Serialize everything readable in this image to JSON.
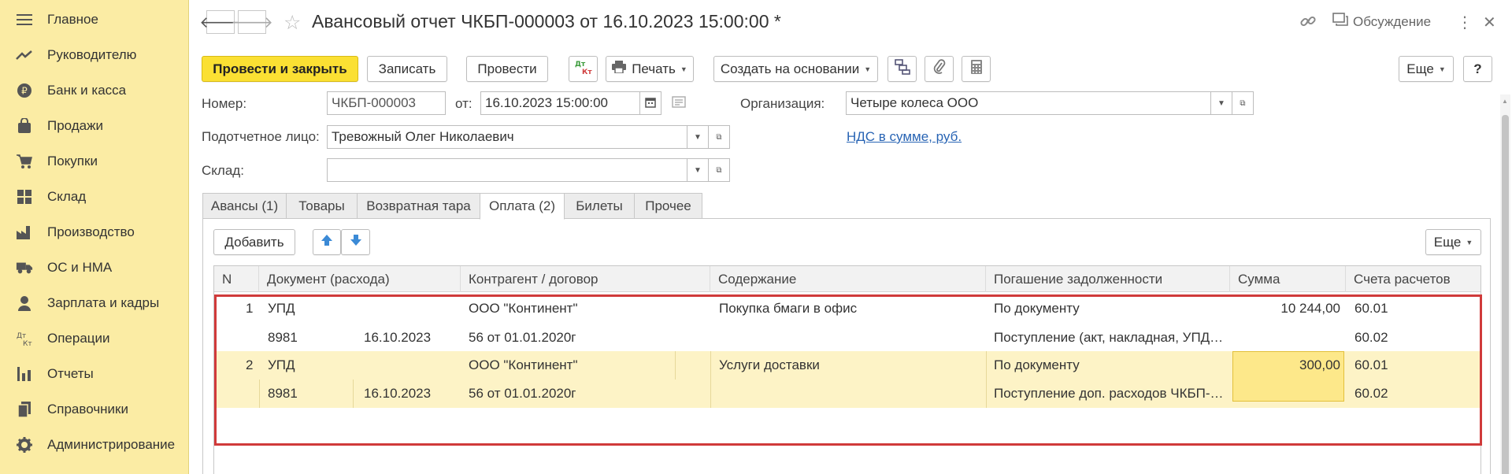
{
  "sidebar": {
    "items": [
      {
        "label": "Главное",
        "icon": "menu-icon"
      },
      {
        "label": "Руководителю",
        "icon": "trend-icon"
      },
      {
        "label": "Банк и касса",
        "icon": "ruble-coin-icon"
      },
      {
        "label": "Продажи",
        "icon": "shopping-bag-icon"
      },
      {
        "label": "Покупки",
        "icon": "cart-icon"
      },
      {
        "label": "Склад",
        "icon": "grid-icon"
      },
      {
        "label": "Производство",
        "icon": "factory-icon"
      },
      {
        "label": "ОС и НМА",
        "icon": "truck-icon"
      },
      {
        "label": "Зарплата и кадры",
        "icon": "person-icon"
      },
      {
        "label": "Операции",
        "icon": "dt-kt-icon"
      },
      {
        "label": "Отчеты",
        "icon": "bar-chart-icon"
      },
      {
        "label": "Справочники",
        "icon": "book-icon"
      },
      {
        "label": "Администрирование",
        "icon": "gear-icon"
      }
    ]
  },
  "header": {
    "title": "Авансовый отчет ЧКБП-000003 от 16.10.2023 15:00:00 *",
    "discussion": "Обсуждение"
  },
  "toolbar": {
    "post_close": "Провести и закрыть",
    "write": "Записать",
    "post": "Провести",
    "print": "Печать",
    "create_based": "Создать на основании",
    "more": "Еще",
    "help": "?"
  },
  "form": {
    "number_label": "Номер:",
    "number_value": "ЧКБП-000003",
    "from_label": "от:",
    "date_value": "16.10.2023 15:00:00",
    "org_label": "Организация:",
    "org_value": "Четыре колеса ООО",
    "person_label": "Подотчетное лицо:",
    "person_value": "Тревожный Олег Николаевич",
    "vat_link": "НДС в сумме, руб.",
    "warehouse_label": "Склад:",
    "warehouse_value": ""
  },
  "tabs": [
    {
      "label": "Авансы (1)"
    },
    {
      "label": "Товары"
    },
    {
      "label": "Возвратная тара"
    },
    {
      "label": "Оплата (2)"
    },
    {
      "label": "Билеты"
    },
    {
      "label": "Прочее"
    }
  ],
  "panel": {
    "add": "Добавить",
    "more": "Еще"
  },
  "table": {
    "headers": [
      "N",
      "Документ (расхода)",
      "Контрагент / договор",
      "Содержание",
      "Погашение задолженности",
      "Сумма",
      "Счета расчетов"
    ],
    "rows": [
      {
        "n": "1",
        "doc_type": "УПД",
        "doc_number": "8981",
        "doc_date": "16.10.2023",
        "counterparty": "ООО \"Континент\"",
        "contract": "56 от 01.01.2020г",
        "content": "Покупка бмаги в офис",
        "repayment": "По документу",
        "repayment2": "Поступление (акт, накладная, УПД…",
        "sum": "10 244,00",
        "account1": "60.01",
        "account2": "60.02"
      },
      {
        "n": "2",
        "doc_type": "УПД",
        "doc_number": "8981",
        "doc_date": "16.10.2023",
        "counterparty": "ООО \"Континент\"",
        "contract": "56 от 01.01.2020г",
        "content": "Услуги доставки",
        "repayment": "По документу",
        "repayment2": "Поступление доп. расходов ЧКБП-…",
        "sum": "300,00",
        "account1": "60.01",
        "account2": "60.02"
      }
    ]
  },
  "colors": {
    "sidebar_bg": "#fbeca4",
    "primary_button": "#fbe033",
    "selected_row": "#fdf3c6",
    "selected_cell": "#fde88a",
    "highlight_border": "#d03a3a",
    "link": "#2864b4"
  }
}
